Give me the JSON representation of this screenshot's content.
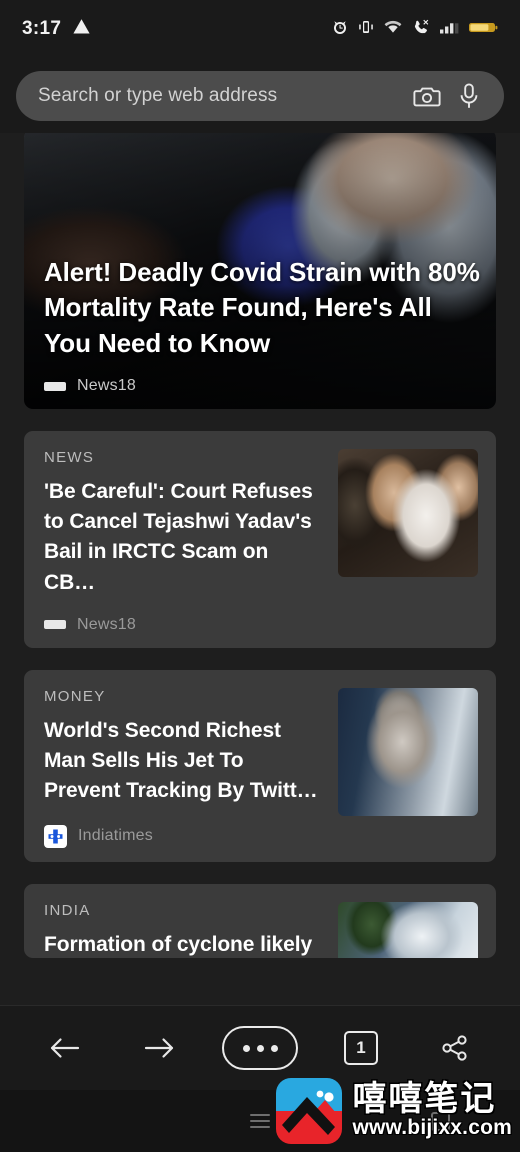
{
  "status_bar": {
    "time": "3:17",
    "icons": [
      "warning-triangle-icon",
      "alarm-clock-icon",
      "vibrate-icon",
      "wifi-icon",
      "call-icon",
      "signal-bars-icon",
      "battery-icon"
    ]
  },
  "omnibox": {
    "placeholder": "Search or type web address",
    "value": "",
    "camera_icon": "camera-icon",
    "mic_icon": "microphone-icon"
  },
  "feed": {
    "hero": {
      "title": "Alert! Deadly Covid Strain with 80% Mortality Rate Found, Here's All You Need to Know",
      "source": "News18",
      "source_icon": "news18-logo-icon"
    },
    "cards": [
      {
        "category": "NEWS",
        "title": "'Be Careful': Court Refuses to Cancel Tejashwi Yadav's Bail in IRCTC Scam on CB…",
        "source": "News18",
        "source_icon": "news18-logo-icon",
        "thumb": "thumb-a"
      },
      {
        "category": "MONEY",
        "title": "World's Second Richest Man Sells His Jet To Prevent Tracking By Twitt…",
        "source": "Indiatimes",
        "source_icon": "indiatimes-logo-icon",
        "thumb": "thumb-b"
      },
      {
        "category": "INDIA",
        "title": "Formation of cyclone likely",
        "source": "",
        "source_icon": "",
        "thumb": "thumb-c"
      }
    ]
  },
  "toolbar": {
    "back_label": "Back",
    "forward_label": "Forward",
    "menu_label": "Menu",
    "tab_count": "1",
    "share_label": "Share"
  },
  "navbar": {
    "recents_label": "Recents",
    "home_label": "Home"
  },
  "watermark": {
    "brand_cn": "嘻嘻笔记",
    "url": "www.bijixx.com"
  },
  "colors": {
    "page_bg": "#1e1e1e",
    "chrome_bg": "#1a1a1a",
    "card_bg": "#3b3b3b",
    "omnibox_bg": "#4c4c4c",
    "accent_blue": "#29a8e0",
    "accent_red": "#e8242a"
  }
}
